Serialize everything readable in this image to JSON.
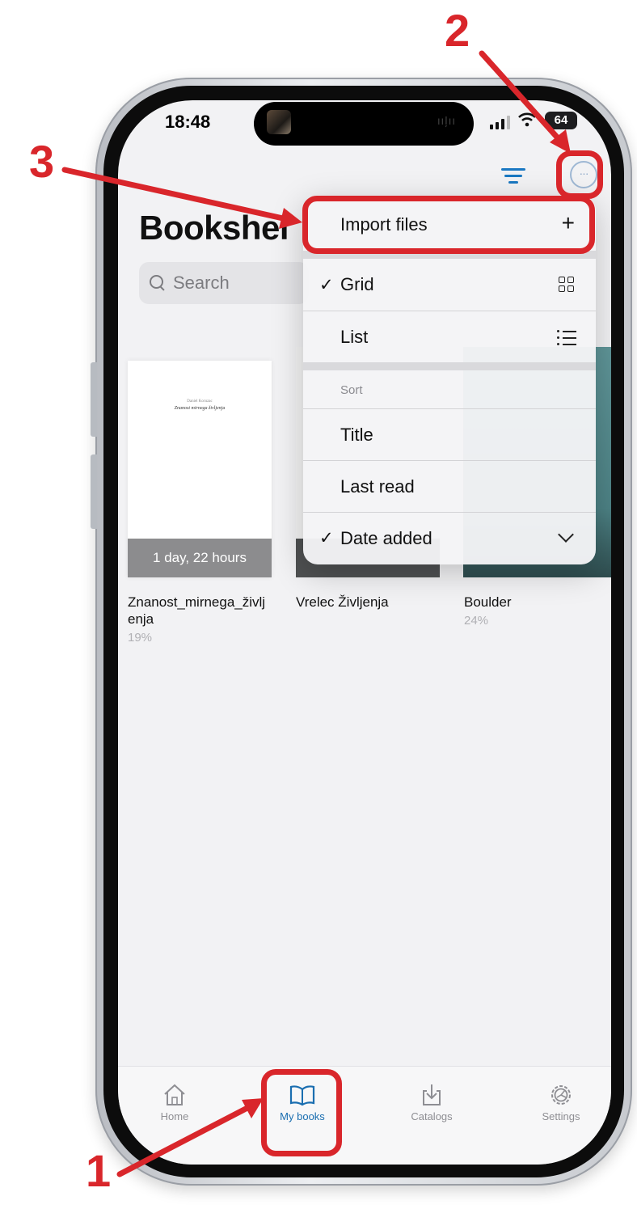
{
  "status_bar": {
    "time": "18:48",
    "battery": "64",
    "island_audio": "ııļıı"
  },
  "toolbar": {
    "filter_icon": "filter-lines-icon",
    "more_icon": "ellipsis-circle-icon",
    "more_glyph": "···"
  },
  "page": {
    "title": "Bookshel",
    "search_placeholder": "Search"
  },
  "books": [
    {
      "cover_author": "Daniel Koruzac",
      "cover_title": "Znanost mirnega življenja",
      "time_left": "1 day, 22 hours",
      "title": "Znanost_mirnega_življenja",
      "progress": "19%"
    },
    {
      "title": "Vrelec Življenja",
      "progress": ""
    },
    {
      "title": "Boulder",
      "progress": "24%"
    }
  ],
  "menu": {
    "import_label": "Import files",
    "import_glyph": "+",
    "checkmark": "✓",
    "grid_label": "Grid",
    "grid_checked": true,
    "list_label": "List",
    "sort_header": "Sort",
    "title_label": "Title",
    "last_read_label": "Last read",
    "date_added_label": "Date added",
    "date_added_checked": true
  },
  "tabs": [
    {
      "label": "Home",
      "icon": "home-icon",
      "active": false
    },
    {
      "label": "My books",
      "icon": "open-book-icon",
      "active": true
    },
    {
      "label": "Catalogs",
      "icon": "download-tray-icon",
      "active": false
    },
    {
      "label": "Settings",
      "icon": "gear-icon",
      "active": false
    }
  ],
  "annotations": {
    "step1": "1",
    "step2": "2",
    "step3": "3",
    "color": "#d9262b"
  }
}
